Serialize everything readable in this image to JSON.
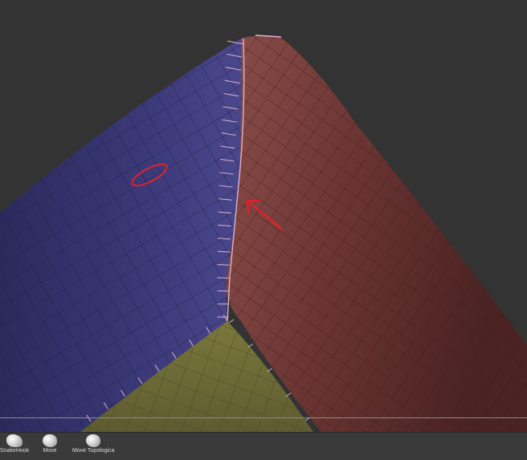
{
  "shelf": {
    "brushes": [
      {
        "label": "SnakeHook",
        "icon": "snakehook-brush-icon"
      },
      {
        "label": "Move",
        "icon": "move-brush-icon"
      },
      {
        "label": "Move Topologica",
        "icon": "move-topological-brush-icon"
      }
    ]
  },
  "colors": {
    "background": "#333333",
    "blue_surface": "#3a3873",
    "red_surface": "#6b3434",
    "yellow_surface": "#6d6b3a",
    "annotation": "#e0212c"
  }
}
